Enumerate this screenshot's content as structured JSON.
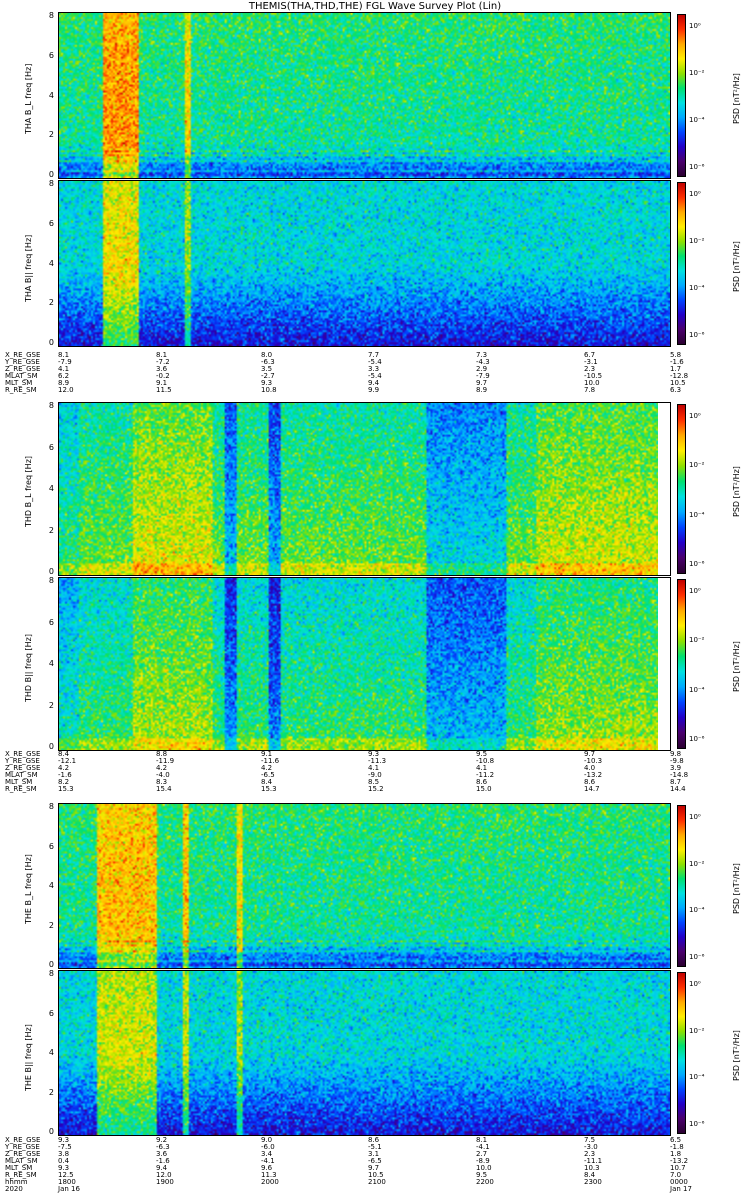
{
  "title": "THEMIS(THA,THD,THE) FGL Wave Survey Plot (Lin)",
  "colors": {
    "colorbar": [
      "#2a0030",
      "#4a006e",
      "#2200c8",
      "#0044ff",
      "#00aaff",
      "#00e0e0",
      "#00e070",
      "#8ee000",
      "#ffee00",
      "#ffaa00",
      "#ff3000",
      "#c00000"
    ]
  },
  "chart_data": [
    {
      "type": "heatmap",
      "panels": [
        {
          "ylabel": "THA B_L\nfreq [Hz]",
          "probe": "tha",
          "kind": "perp"
        },
        {
          "ylabel": "THA B||\nfreq [Hz]",
          "probe": "tha",
          "kind": "par"
        }
      ],
      "yticks": [
        "0",
        "2",
        "4",
        "6",
        "8"
      ],
      "ylim": [
        0,
        8
      ],
      "colorbar_label": "PSD [nT²/Hz]",
      "colorbar_ticks": [
        "10⁰",
        "10⁻²",
        "10⁻⁴",
        "10⁻⁶"
      ],
      "ephemeris": {
        "labels": [
          "X_RE_GSE",
          "Y_RE_GSE",
          "Z_RE_GSE",
          "MLAT_SM",
          "MLT_SM",
          "R_RE_SM"
        ],
        "columns": [
          [
            "8.1",
            "-7.9",
            "4.1",
            "6.2",
            "8.9",
            "12.0"
          ],
          [
            "8.1",
            "-7.2",
            "3.6",
            "-0.2",
            "9.1",
            "11.5"
          ],
          [
            "8.0",
            "-6.3",
            "3.5",
            "-2.7",
            "9.3",
            "10.8"
          ],
          [
            "7.7",
            "-5.4",
            "3.3",
            "-5.4",
            "9.4",
            "9.9"
          ],
          [
            "7.3",
            "-4.3",
            "2.9",
            "-7.9",
            "9.7",
            "8.9"
          ],
          [
            "6.7",
            "-3.1",
            "2.3",
            "-10.5",
            "10.0",
            "7.8"
          ],
          [
            "5.8",
            "-1.6",
            "1.7",
            "-12.8",
            "10.5",
            "6.3"
          ]
        ]
      }
    },
    {
      "type": "heatmap",
      "panels": [
        {
          "ylabel": "THD B_L\nfreq [Hz]",
          "probe": "thd",
          "kind": "perp"
        },
        {
          "ylabel": "THD B||\nfreq [Hz]",
          "probe": "thd",
          "kind": "par"
        }
      ],
      "yticks": [
        "0",
        "2",
        "4",
        "6",
        "8"
      ],
      "ylim": [
        0,
        8
      ],
      "colorbar_label": "PSD [nT²/Hz]",
      "colorbar_ticks": [
        "10⁰",
        "10⁻²",
        "10⁻⁴",
        "10⁻⁶"
      ],
      "ephemeris": {
        "labels": [
          "X_RE_GSE",
          "Y_RE_GSE",
          "Z_RE_GSE",
          "MLAT_SM",
          "MLT_SM",
          "R_RE_SM"
        ],
        "columns": [
          [
            "8.4",
            "-12.1",
            "4.2",
            "-1.6",
            "8.2",
            "15.3"
          ],
          [
            "8.8",
            "-11.9",
            "4.2",
            "-4.0",
            "8.3",
            "15.4"
          ],
          [
            "9.1",
            "-11.6",
            "4.2",
            "-6.5",
            "8.4",
            "15.3"
          ],
          [
            "9.3",
            "-11.3",
            "4.1",
            "-9.0",
            "8.5",
            "15.2"
          ],
          [
            "9.5",
            "-10.8",
            "4.1",
            "-11.2",
            "8.6",
            "15.0"
          ],
          [
            "9.7",
            "-10.3",
            "4.0",
            "-13.2",
            "8.6",
            "14.7"
          ],
          [
            "9.8",
            "-9.8",
            "3.9",
            "-14.8",
            "8.7",
            "14.4"
          ]
        ]
      }
    },
    {
      "type": "heatmap",
      "panels": [
        {
          "ylabel": "THE B_L\nfreq [Hz]",
          "probe": "the",
          "kind": "perp"
        },
        {
          "ylabel": "THE B||\nfreq [Hz]",
          "probe": "the",
          "kind": "par"
        }
      ],
      "yticks": [
        "0",
        "2",
        "4",
        "6",
        "8"
      ],
      "ylim": [
        0,
        8
      ],
      "colorbar_label": "PSD [nT²/Hz]",
      "colorbar_ticks": [
        "10⁰",
        "10⁻²",
        "10⁻⁴",
        "10⁻⁶"
      ],
      "ephemeris": {
        "labels": [
          "X_RE_GSE",
          "Y_RE_GSE",
          "Z_RE_GSE",
          "MLAT_SM",
          "MLT_SM",
          "R_RE_SM",
          "hhmm",
          "2020"
        ],
        "columns": [
          [
            "9.3",
            "-7.5",
            "3.8",
            "0.4",
            "9.3",
            "12.5",
            "1800",
            "Jan 16"
          ],
          [
            "9.2",
            "-6.3",
            "3.6",
            "-1.6",
            "9.4",
            "12.0",
            "1900",
            ""
          ],
          [
            "9.0",
            "-6.0",
            "3.4",
            "-4.1",
            "9.6",
            "11.3",
            "2000",
            ""
          ],
          [
            "8.6",
            "-5.1",
            "3.1",
            "-6.5",
            "9.7",
            "10.5",
            "2100",
            ""
          ],
          [
            "8.1",
            "-4.1",
            "2.7",
            "-8.9",
            "10.0",
            "9.5",
            "2200",
            ""
          ],
          [
            "7.5",
            "-3.0",
            "2.3",
            "-11.1",
            "10.3",
            "8.4",
            "2300",
            ""
          ],
          [
            "6.5",
            "-1.8",
            "1.8",
            "-13.2",
            "10.7",
            "7.0",
            "0000",
            "Jan 17"
          ]
        ]
      }
    }
  ]
}
